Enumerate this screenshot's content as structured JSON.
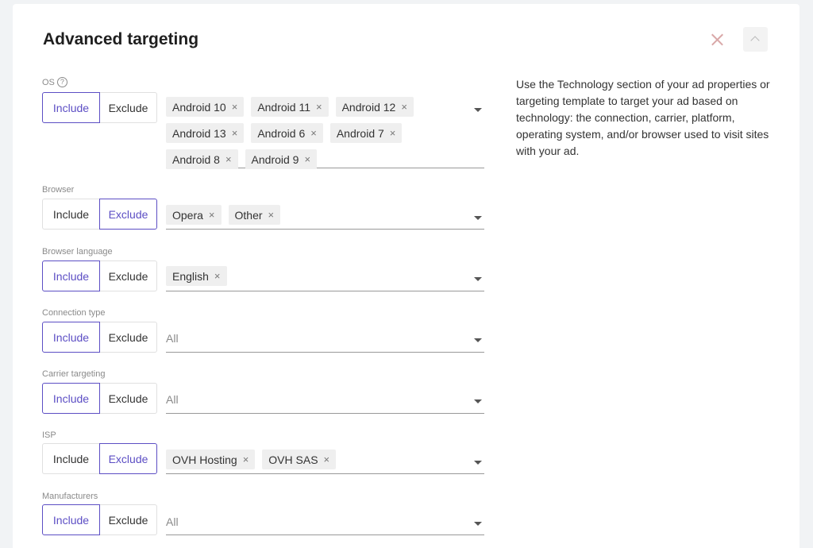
{
  "panel": {
    "title": "Advanced targeting"
  },
  "info_text": "Use the Technology section of your ad properties or targeting template to target your ad based on technology: the connection, carrier, platform, operating system, and/or browser used to visit sites with your ad.",
  "toggle_labels": {
    "include": "Include",
    "exclude": "Exclude"
  },
  "remove_glyph": "×",
  "help_glyph": "?",
  "sections": [
    {
      "label": "OS",
      "has_help": true,
      "mode": "Include",
      "chips": [
        "Android 10",
        "Android 11",
        "Android 12",
        "Android 13",
        "Android 6",
        "Android 7",
        "Android 8",
        "Android 9"
      ],
      "placeholder": ""
    },
    {
      "label": "Browser",
      "has_help": false,
      "mode": "Exclude",
      "chips": [
        "Opera",
        "Other"
      ],
      "placeholder": ""
    },
    {
      "label": "Browser language",
      "has_help": false,
      "mode": "Include",
      "chips": [
        "English"
      ],
      "placeholder": ""
    },
    {
      "label": "Connection type",
      "has_help": false,
      "mode": "Include",
      "chips": [],
      "placeholder": "All"
    },
    {
      "label": "Carrier targeting",
      "has_help": false,
      "mode": "Include",
      "chips": [],
      "placeholder": "All"
    },
    {
      "label": "ISP",
      "has_help": false,
      "mode": "Exclude",
      "chips": [
        "OVH Hosting",
        "OVH SAS"
      ],
      "placeholder": ""
    },
    {
      "label": "Manufacturers",
      "has_help": false,
      "mode": "Include",
      "chips": [],
      "placeholder": "All"
    }
  ],
  "colors": {
    "accent": "#5c4ec4",
    "close_icon": "#d9a8a8",
    "chip_bg": "#efefef"
  },
  "icons": {
    "close": "close-icon",
    "collapse": "chevron-up-icon",
    "dropdown": "chevron-down-icon",
    "help": "help-circle-icon",
    "chip_remove": "remove-icon"
  }
}
